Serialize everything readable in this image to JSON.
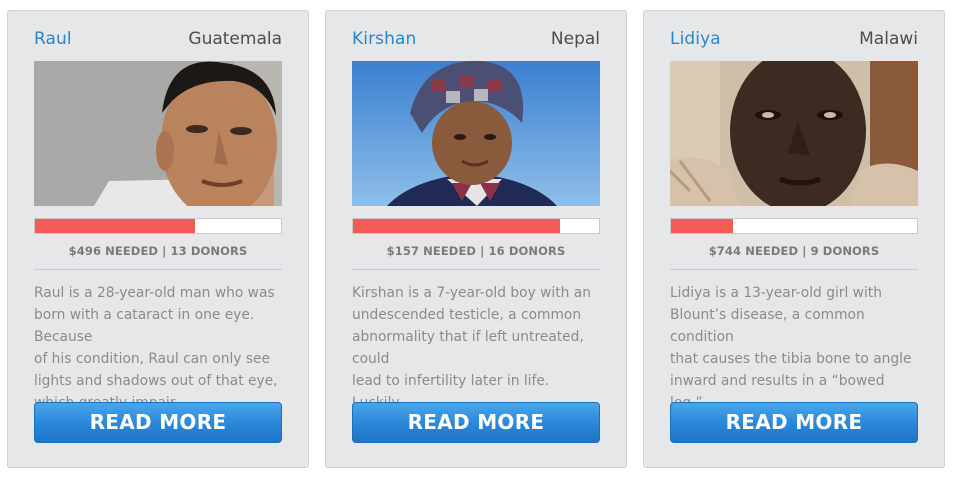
{
  "patients": [
    {
      "name": "Raul",
      "country": "Guatemala",
      "stats": "$496 NEEDED | 13 DONORS",
      "progress_fraction": 0.65,
      "description": "Raul is a 28-year-old man who was\nborn with a cataract in one eye. Because\nof his condition, Raul can only see\nlights and shadows out of that eye,\nwhich greatly impair...",
      "button_label": "READ MORE"
    },
    {
      "name": "Kirshan",
      "country": "Nepal",
      "stats": "$157 NEEDED | 16 DONORS",
      "progress_fraction": 0.84,
      "description": "Kirshan is a 7-year-old boy with an\nundescended testicle, a common\nabnormality that if left untreated, could\nlead to infertility later in life. Luckily,\nKirshan c...",
      "button_label": "READ MORE"
    },
    {
      "name": "Lidiya",
      "country": "Malawi",
      "stats": "$744 NEEDED | 9 DONORS",
      "progress_fraction": 0.25,
      "description": "Lidiya is a 13-year-old girl with\nBlount’s disease, a common condition\nthat causes the tibia bone to angle\ninward and results in a “bowed leg.”\nBecause of her conditio...",
      "button_label": "READ MORE"
    }
  ],
  "colors": {
    "name": "#2c86c6",
    "progress_fill": "#f45b55",
    "button": "#2a86d8"
  }
}
